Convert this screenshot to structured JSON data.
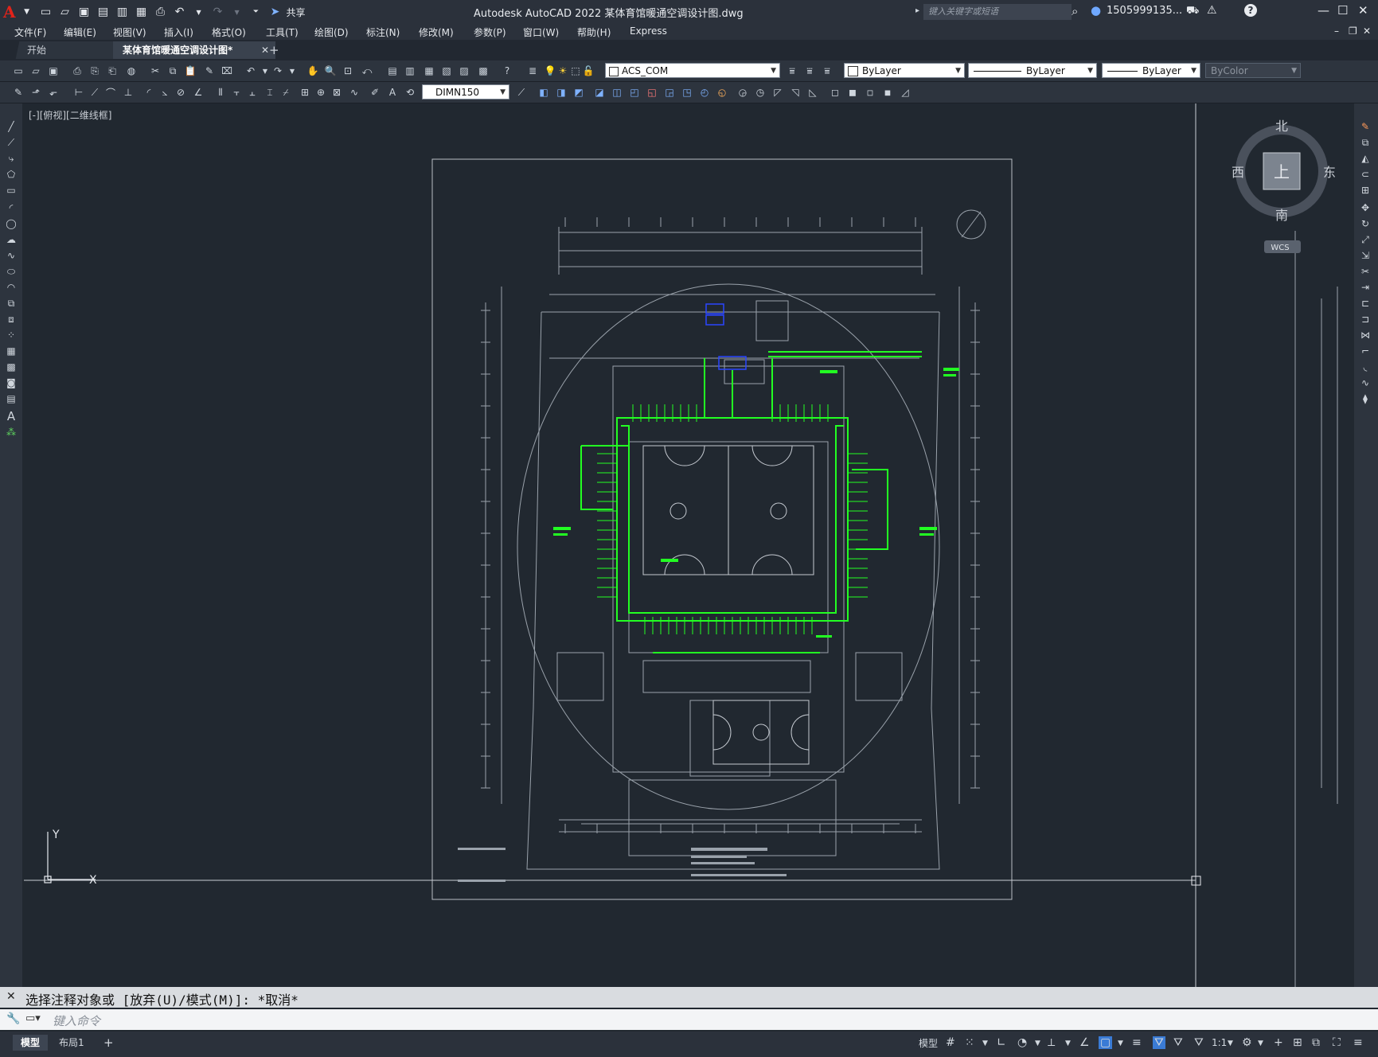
{
  "titlebar": {
    "app_title": "Autodesk AutoCAD 2022    某体育馆暖通空调设计图.dwg",
    "share_label": "共享",
    "search_placeholder": "键入关键字或短语",
    "user": "1505999135...",
    "help": "?"
  },
  "menu": [
    "文件(F)",
    "编辑(E)",
    "视图(V)",
    "插入(I)",
    "格式(O)",
    "工具(T)",
    "绘图(D)",
    "标注(N)",
    "修改(M)",
    "参数(P)",
    "窗口(W)",
    "帮助(H)",
    "Express"
  ],
  "tabs": {
    "start": "开始",
    "doc": "某体育馆暖通空调设计图*",
    "add": "+"
  },
  "toolbar": {
    "layer": "ACS_COM",
    "color": "ByLayer",
    "linetype": "ByLayer",
    "lineweight": "ByLayer",
    "plotstyle": "ByColor",
    "dimstyle": "DIMN150"
  },
  "viewport": {
    "label": "[-][俯视][二维线框]"
  },
  "viewcube": {
    "north": "北",
    "south": "南",
    "east": "东",
    "west": "西",
    "top": "上",
    "wcs": "WCS"
  },
  "ucs": {
    "x": "X",
    "y": "Y"
  },
  "command": {
    "history": "选择注释对象或 [放弃(U)/模式(M)]: *取消*",
    "placeholder": "键入命令"
  },
  "status": {
    "model_tab": "模型",
    "layout_tab": "布局1",
    "add": "+",
    "model_btn": "模型",
    "scale": "1:1"
  },
  "colors": {
    "bg": "#212830",
    "chrome": "#2b313b",
    "duct": "#22ff22",
    "arch": "#9aa2ab",
    "accent": "#3a7bd5"
  }
}
